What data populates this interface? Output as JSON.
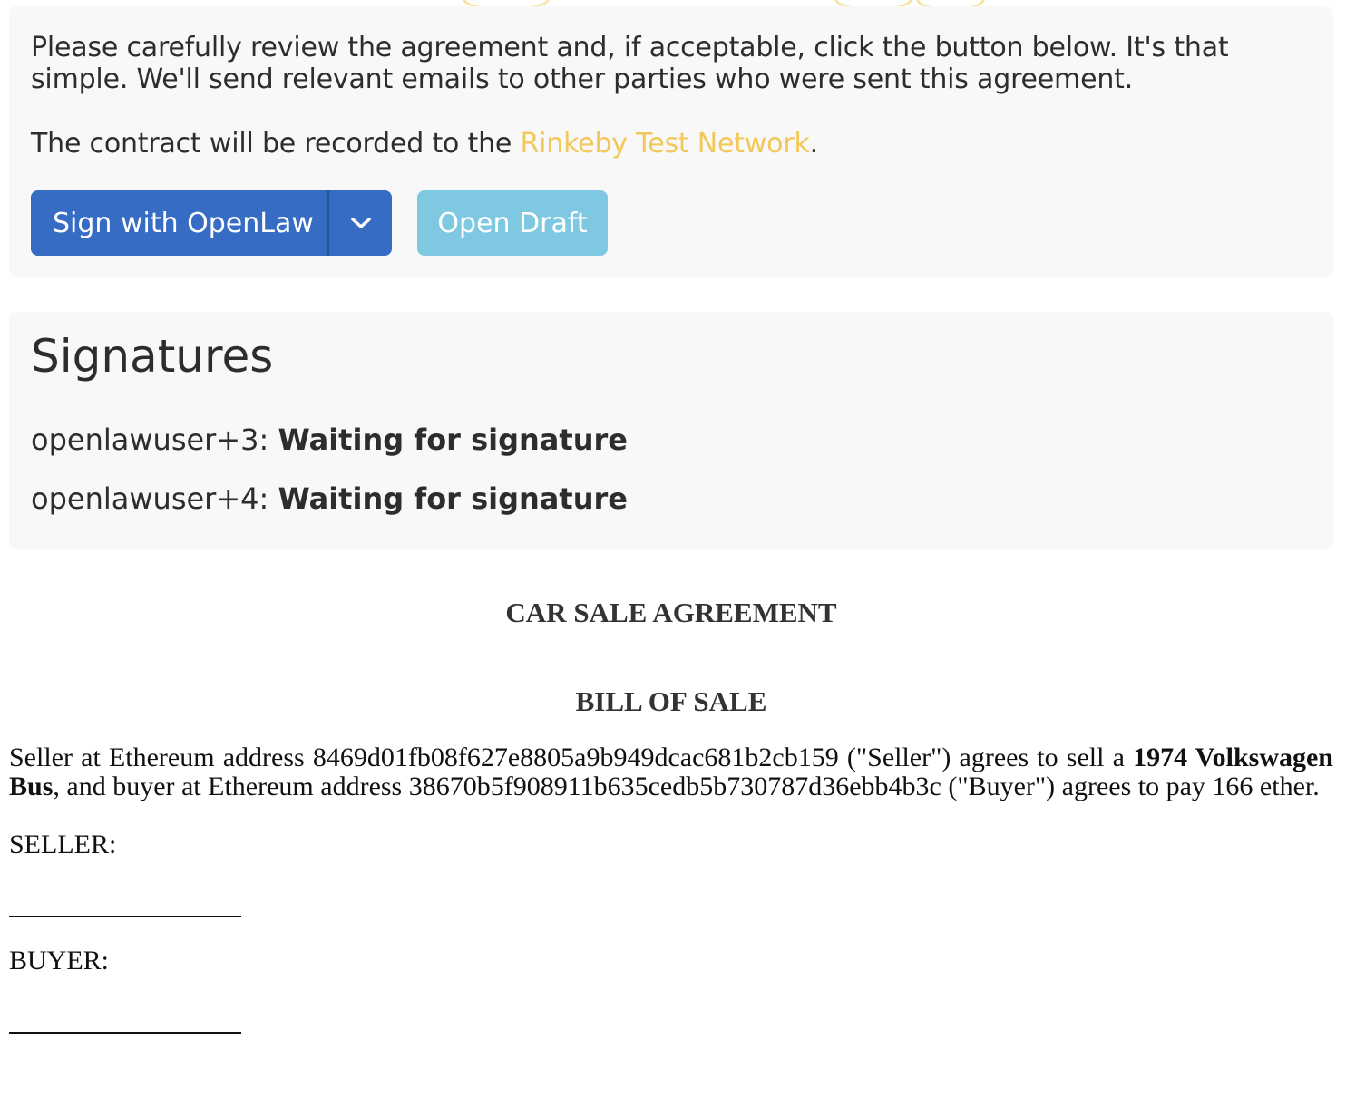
{
  "sign_panel": {
    "instructions": "Please carefully review the agreement and, if acceptable, click the button below. It's that simple. We'll send relevant emails to other parties who were sent this agreement.",
    "network_prefix": "The contract will be recorded to the ",
    "network_link": "Rinkeby Test Network",
    "network_suffix": ".",
    "sign_button_label": "Sign with OpenLaw",
    "dropdown_icon": "chevron-down-icon",
    "draft_button_label": "Open Draft"
  },
  "signatures": {
    "title": "Signatures",
    "items": [
      {
        "user": "openlawuser+3",
        "separator": ": ",
        "status": "Waiting for signature"
      },
      {
        "user": "openlawuser+4",
        "separator": ": ",
        "status": "Waiting for signature"
      }
    ]
  },
  "document": {
    "title": "CAR SALE AGREEMENT",
    "subtitle": "BILL OF SALE",
    "body": {
      "part1": "Seller at Ethereum address 8469d01fb08f627e8805a9b949dcac681b2cb159 (\"Seller\") agrees to sell a ",
      "vehicle": "1974 Volkswagen Bus",
      "part2": ", and buyer at Ethereum address 38670b5f908911b635cedb5b730787d36ebb4b3c (\"Buyer\") agrees to pay 166 ether."
    },
    "seller_label": "SELLER:",
    "buyer_label": "BUYER:"
  },
  "colors": {
    "primary_button": "#376cc4",
    "info_button": "#7ec8e2",
    "link": "#f2c85a",
    "panel_background": "#f8f8f8"
  }
}
